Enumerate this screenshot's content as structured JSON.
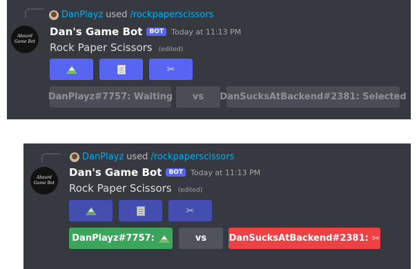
{
  "messages": [
    {
      "reply": {
        "user": "DanPlayz",
        "used": "used",
        "command": "/rockpaperscissors"
      },
      "author": {
        "name": "Dan's Game Bot",
        "badge": "BOT",
        "timestamp": "Today at 11:13 PM",
        "avatar_text": "Absurd Game Bot"
      },
      "content": "Rock Paper Scissors",
      "edited": "(edited)",
      "choices": [
        {
          "icon": "mountain-icon",
          "label": "Rock"
        },
        {
          "icon": "page-icon",
          "label": "Paper"
        },
        {
          "icon": "scissors-icon",
          "label": "Scissors"
        }
      ],
      "status": {
        "player1": "DanPlayz#7757: Waiting",
        "vs": "vs",
        "player2": "DanSucksAtBackend#2381: Selected"
      }
    },
    {
      "reply": {
        "user": "DanPlayz",
        "used": "used",
        "command": "/rockpaperscissors"
      },
      "author": {
        "name": "Dan's Game Bot",
        "badge": "BOT",
        "timestamp": "Today at 11:13 PM",
        "avatar_text": "Absurd Game Bot"
      },
      "content": "Rock Paper Scissors",
      "edited": "(edited)",
      "choices": [
        {
          "icon": "mountain-icon",
          "label": "Rock"
        },
        {
          "icon": "page-icon",
          "label": "Paper"
        },
        {
          "icon": "scissors-icon",
          "label": "Scissors"
        }
      ],
      "status": {
        "player1": "DanPlayz#7757:",
        "vs": "vs",
        "player2": "DanSucksAtBackend#2381:"
      }
    }
  ],
  "colors": {
    "background": "#36393f",
    "blurple": "#5865f2",
    "green": "#3ba55c",
    "red": "#ed4245",
    "grey": "#4f545c",
    "link": "#00aff4"
  }
}
